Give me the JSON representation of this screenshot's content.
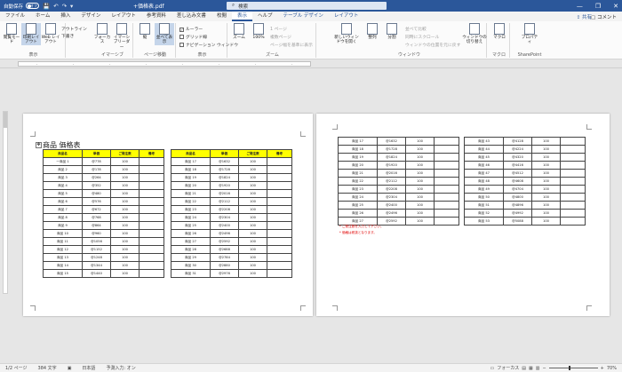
{
  "titlebar": {
    "autosave_label": "自動保存",
    "autosave_state": "オフ",
    "save_icon": "save-icon",
    "undo_icon": "undo-icon",
    "doc_title": "+価格表.pdf",
    "search_placeholder": "検索",
    "minimize": "—",
    "restore": "❐",
    "close": "✕"
  },
  "menu": {
    "tabs": [
      "ファイル",
      "ホーム",
      "挿入",
      "デザイン",
      "レイアウト",
      "参考資料",
      "差し込み文書",
      "校閲",
      "表示",
      "ヘルプ",
      "テーブル デザイン",
      "レイアウト"
    ],
    "active_index": 8,
    "share": "共有",
    "comment": "コメント"
  },
  "ribbon": {
    "groups": {
      "view": "表示",
      "immersive": "イマーシブ",
      "page_move": "ページ移動",
      "show": "表示",
      "zoom": "ズーム",
      "window": "ウィンドウ",
      "macro": "マクロ",
      "sharepoint": "SharePoint"
    },
    "read_mode": "閲覧モード",
    "print_layout": "印刷レイアウト",
    "web_layout": "Web レイアウト",
    "outline": "アウトライン",
    "draft": "下書き",
    "focus": "フォーカス",
    "immersive_reader": "イマーシブリーダー",
    "vertical": "縦",
    "side_by_side": "並べて表示",
    "ruler": "ルーラー",
    "gridlines": "グリッド線",
    "nav_pane": "ナビゲーション ウィンドウ",
    "zoom": "ズーム",
    "hundred": "100%",
    "one_page": "1 ページ",
    "multi_page": "複数ページ",
    "page_width": "ページ幅を基準に表示",
    "new_window": "新しいウィンドウを開く",
    "arrange": "整列",
    "split": "分割",
    "side_by_side_compare": "並べて比較",
    "sync_scroll": "同時にスクロール",
    "reset_pos": "ウィンドウの位置を元に戻す",
    "switch_window": "ウィンドウの切り替え",
    "macro": "マクロ",
    "properties": "プロパティ"
  },
  "document": {
    "title": "商品 価格表",
    "headers": [
      "商品名",
      "単価",
      "ご発注数",
      "備考"
    ],
    "table1": [
      [
        "一商品 1",
        "@778",
        "100",
        ""
      ],
      [
        "商品 2",
        "@178",
        "100",
        ""
      ],
      [
        "商品 3",
        "@264",
        "100",
        ""
      ],
      [
        "商品 4",
        "@352",
        "100",
        ""
      ],
      [
        "商品 5",
        "@480",
        "100",
        ""
      ],
      [
        "商品 6",
        "@576",
        "100",
        ""
      ],
      [
        "商品 7",
        "@672",
        "100",
        ""
      ],
      [
        "商品 8",
        "@768",
        "100",
        ""
      ],
      [
        "商品 9",
        "@864",
        "100",
        ""
      ],
      [
        "商品 10",
        "@960",
        "100",
        ""
      ],
      [
        "商品 11",
        "@1056",
        "100",
        ""
      ],
      [
        "商品 12",
        "@1152",
        "100",
        ""
      ],
      [
        "商品 13",
        "@1248",
        "100",
        ""
      ],
      [
        "商品 14",
        "@1344",
        "100",
        ""
      ],
      [
        "商品 15",
        "@1440",
        "100",
        ""
      ]
    ],
    "table2": [
      [
        "商品 17",
        "@1632",
        "100",
        ""
      ],
      [
        "商品 18",
        "@1728",
        "100",
        ""
      ],
      [
        "商品 19",
        "@1824",
        "100",
        ""
      ],
      [
        "商品 20",
        "@1920",
        "100",
        ""
      ],
      [
        "商品 21",
        "@2016",
        "100",
        ""
      ],
      [
        "商品 22",
        "@2112",
        "100",
        ""
      ],
      [
        "商品 23",
        "@2208",
        "100",
        ""
      ],
      [
        "商品 24",
        "@2304",
        "100",
        ""
      ],
      [
        "商品 25",
        "@2400",
        "100",
        ""
      ],
      [
        "商品 26",
        "@2496",
        "100",
        ""
      ],
      [
        "商品 27",
        "@2592",
        "100",
        ""
      ],
      [
        "商品 28",
        "@2688",
        "100",
        ""
      ],
      [
        "商品 29",
        "@2784",
        "100",
        ""
      ],
      [
        "商品 30",
        "@2880",
        "100",
        ""
      ],
      [
        "商品 31",
        "@2976",
        "100",
        ""
      ]
    ],
    "table3": [
      [
        "商品 17",
        "@1632",
        "100",
        ""
      ],
      [
        "商品 18",
        "@1728",
        "100",
        ""
      ],
      [
        "商品 19",
        "@1824",
        "100",
        ""
      ],
      [
        "商品 20",
        "@1920",
        "100",
        ""
      ],
      [
        "商品 21",
        "@2016",
        "100",
        ""
      ],
      [
        "商品 22",
        "@2112",
        "100",
        ""
      ],
      [
        "商品 23",
        "@2208",
        "100",
        ""
      ],
      [
        "商品 24",
        "@2304",
        "100",
        ""
      ],
      [
        "商品 25",
        "@2400",
        "100",
        ""
      ],
      [
        "商品 26",
        "@2496",
        "100",
        ""
      ],
      [
        "商品 27",
        "@2592",
        "100",
        ""
      ]
    ],
    "table4": [
      [
        "商品 43",
        "@4128",
        "100",
        ""
      ],
      [
        "商品 44",
        "@4224",
        "100",
        ""
      ],
      [
        "商品 45",
        "@4320",
        "100",
        ""
      ],
      [
        "商品 46",
        "@4416",
        "100",
        ""
      ],
      [
        "商品 47",
        "@4512",
        "100",
        ""
      ],
      [
        "商品 48",
        "@4608",
        "100",
        ""
      ],
      [
        "商品 49",
        "@4704",
        "100",
        ""
      ],
      [
        "商品 50",
        "@4800",
        "100",
        ""
      ],
      [
        "商品 51",
        "@4896",
        "100",
        ""
      ],
      [
        "商品 52",
        "@4992",
        "100",
        ""
      ],
      [
        "商品 53",
        "@5088",
        "100",
        ""
      ]
    ],
    "note1": "* ご発注数を入力して下さい。",
    "note2": "* 価格は税抜となります。"
  },
  "status": {
    "page": "1/2 ページ",
    "words": "384 文字",
    "lang": "日本語",
    "predict": "予測入力: オン",
    "focus": "フォーカス",
    "zoom": "70%"
  },
  "colors": {
    "accent": "#2b579a",
    "header_fill": "#ffff00",
    "note": "#e00000"
  }
}
